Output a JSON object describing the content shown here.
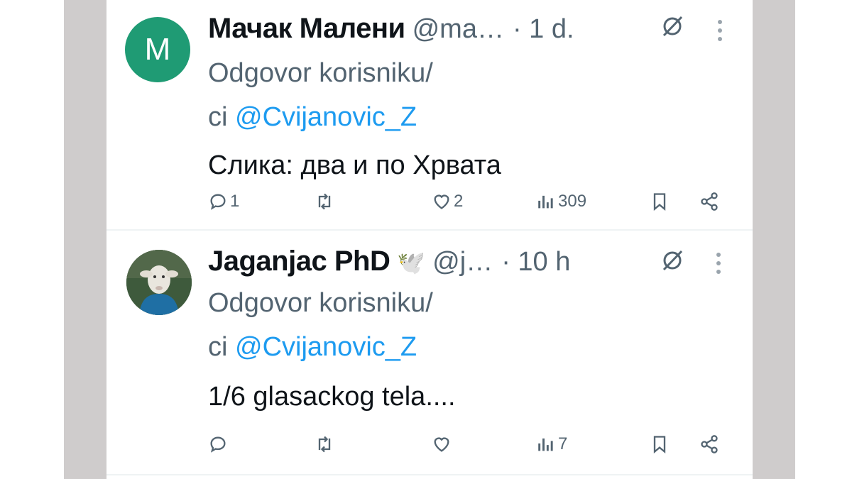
{
  "tweets": [
    {
      "avatar_letter": "M",
      "avatar_color": "#1f9b74",
      "name": "Мачак Малени",
      "handle": "@ma…",
      "time": "· 1 d.",
      "reply_prefix_line1": "Odgovor korisniku/",
      "reply_prefix_line2": "ci",
      "reply_mention": "@Cvijanovic_Z",
      "text": "Слика: два и по Хрвата",
      "reply_count": "1",
      "retweet_count": "",
      "like_count": "2",
      "view_count": "309"
    },
    {
      "avatar_icon": "lamb-avatar",
      "name": "Jaganjac PhD",
      "badge_emoji": "🕊️",
      "handle": "@j…",
      "time": "· 10 h",
      "reply_prefix_line1": "Odgovor korisniku/",
      "reply_prefix_line2": "ci",
      "reply_mention": "@Cvijanovic_Z",
      "text": "1/6 glasackog tela....",
      "reply_count": "",
      "retweet_count": "",
      "like_count": "",
      "view_count": "7"
    }
  ],
  "colors": {
    "link": "#1d9bf0",
    "secondary_text": "#536471",
    "primary_text": "#0f1419",
    "side_bars": "#cfcccc"
  },
  "icons": [
    "grok-icon",
    "more-icon",
    "reply-icon",
    "retweet-icon",
    "like-icon",
    "views-icon",
    "bookmark-icon",
    "share-icon"
  ]
}
